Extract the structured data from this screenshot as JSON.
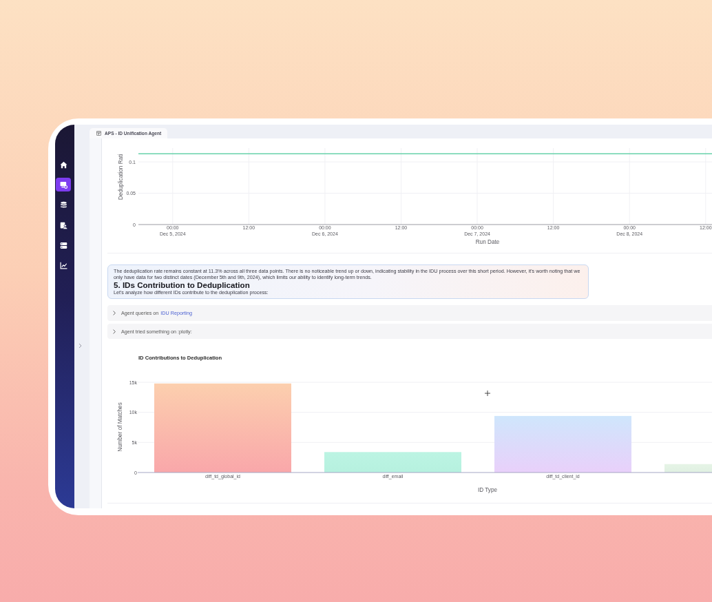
{
  "sidebar": {
    "items": [
      {
        "selected": false
      },
      {
        "selected": true
      },
      {
        "selected": false
      },
      {
        "selected": false
      },
      {
        "selected": false
      },
      {
        "selected": false
      }
    ]
  },
  "tabs": [
    {
      "label": "APS - ID Unification Agent",
      "selected": true
    }
  ],
  "line_chart": {
    "chart_data": {
      "type": "line",
      "xlabel": "Run Date",
      "ylabel": "Deduplication Rati",
      "x": [
        "2024-12-04T18:36",
        "2024-12-08T13:00"
      ],
      "series": [
        {
          "color": "#66d1aa",
          "values": [
            0.113,
            0.113
          ]
        }
      ],
      "xlim": [
        "2024-12-04T18:36",
        "2024-12-08T13:00"
      ],
      "ylim": [
        0,
        0.122
      ],
      "xticks": [
        {
          "value": "2024-12-05T00:00",
          "label": "00:00\nDec 5, 2024"
        },
        {
          "value": "2024-12-05T12:00",
          "label": "12:00"
        },
        {
          "value": "2024-12-06T00:00",
          "label": "00:00\nDec 6, 2024"
        },
        {
          "value": "2024-12-06T12:00",
          "label": "12:00"
        },
        {
          "value": "2024-12-07T00:00",
          "label": "00:00\nDec 7, 2024"
        },
        {
          "value": "2024-12-07T12:00",
          "label": "12:00"
        },
        {
          "value": "2024-12-08T00:00",
          "label": "00:00\nDec 8, 2024"
        },
        {
          "value": "2024-12-08T12:00",
          "label": "12:00"
        }
      ],
      "yticks": [
        0,
        0.05,
        0.1
      ],
      "grid": true
    }
  },
  "message": {
    "paragraph": "The deduplication rate remains constant at 11.3% across all three data points. There is no noticeable trend up or down, indicating stability in the IDU process over this short period. However, it's worth noting that we only have data for two distinct dates (December 5th and 9th, 2024), which limits our ability to identify long-term trends.",
    "heading": "5. IDs Contribution to Deduplication",
    "intro": "Let's analyze how different IDs contribute to the deduplication process:"
  },
  "steps": [
    {
      "label": "Agent queries on",
      "link": "IDU Reporting",
      "expanded": false
    },
    {
      "label": "Agent tried something on :plotly:",
      "expanded": false
    }
  ],
  "bar_chart": {
    "chart_data": {
      "type": "bar",
      "title": "ID Contributions to Deduplication",
      "xlabel": "ID Type",
      "ylabel": "Number of Matches",
      "categories": [
        "diff_td_global_id",
        "diff_email",
        "diff_td_client_id",
        null
      ],
      "values": [
        14800,
        3400,
        9400,
        1400
      ],
      "ylim": [
        0,
        15000
      ],
      "yticks": [
        0,
        {
          "value": 5000,
          "label": "5k"
        },
        {
          "value": 10000,
          "label": "10k"
        },
        {
          "value": 15000,
          "label": "15k"
        }
      ],
      "grid": true
    }
  }
}
